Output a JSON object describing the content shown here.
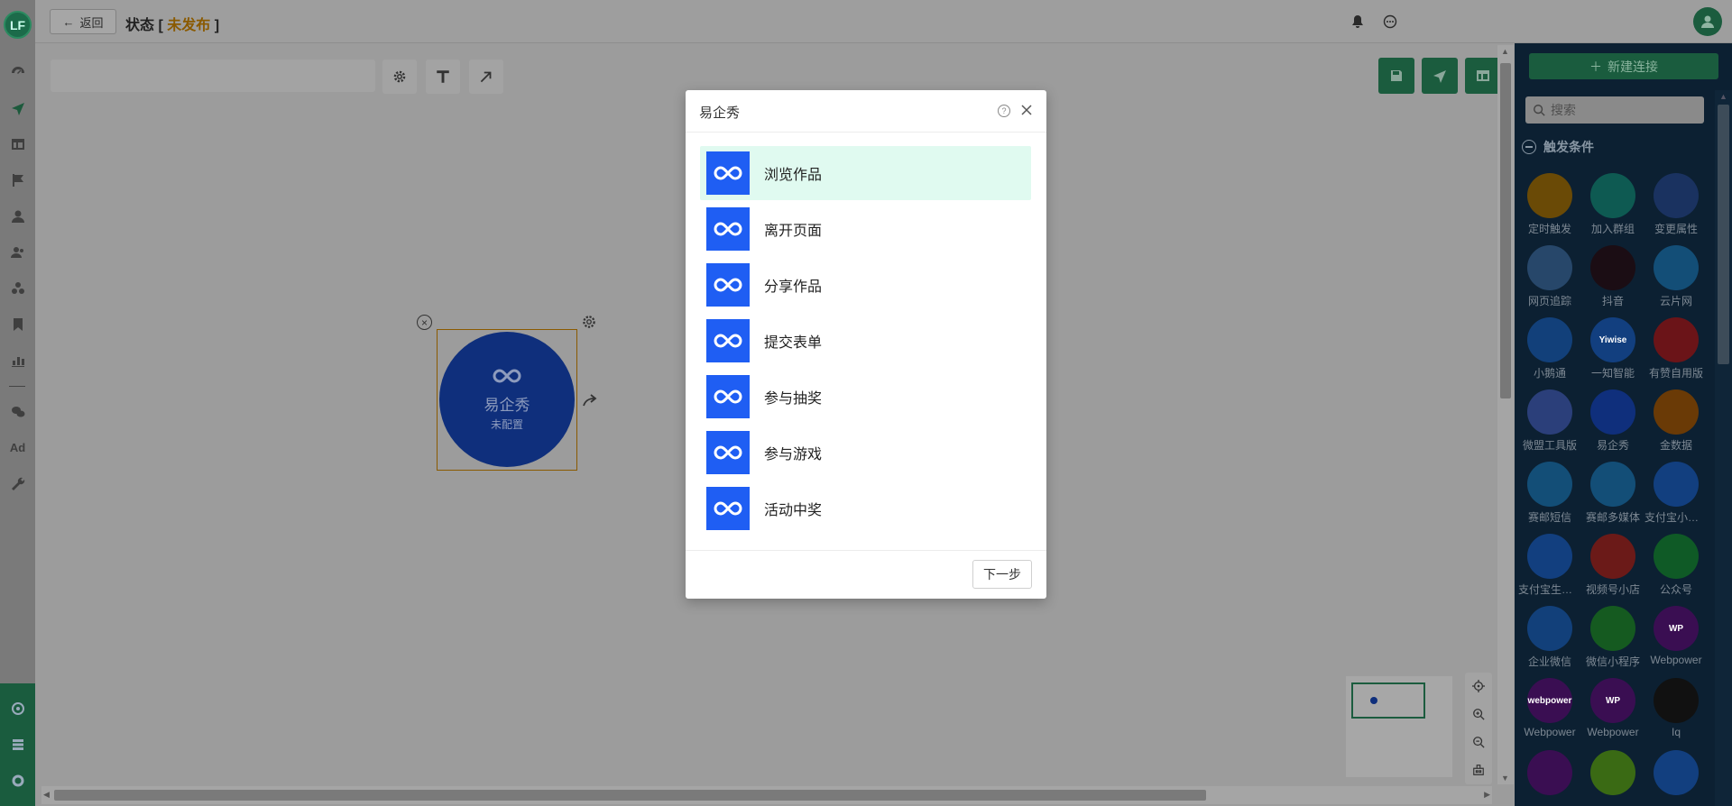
{
  "app": {
    "logo_text": "LF"
  },
  "header": {
    "back_label": "返回",
    "title_prefix": "状态",
    "bracket_open": "[",
    "status": "未发布",
    "bracket_close": "]"
  },
  "left_nav": {
    "items": [
      "dashboard-icon",
      "send-icon",
      "table-icon",
      "flag-icon",
      "user-icon",
      "user-group-icon",
      "segments-icon",
      "bookmark-icon",
      "bar-chart-icon",
      "wechat-icon",
      "wrench-icon"
    ],
    "ad_label": "Ad"
  },
  "canvas": {
    "node": {
      "label": "易企秀",
      "sublabel": "未配置"
    }
  },
  "right_panel": {
    "new_connection": "新建连接",
    "search_placeholder": "搜索",
    "section_title": "触发条件",
    "items": [
      {
        "label": "定时触发",
        "color": "#6a4a06",
        "text": ""
      },
      {
        "label": "加入群组",
        "color": "#0e5a52",
        "text": ""
      },
      {
        "label": "变更属性",
        "color": "#1a3260",
        "text": ""
      },
      {
        "label": "网页追踪",
        "color": "#27476a",
        "text": ""
      },
      {
        "label": "抖音",
        "color": "#1b0d14",
        "text": ""
      },
      {
        "label": "云片网",
        "color": "#134e77",
        "text": ""
      },
      {
        "label": "小鹅通",
        "color": "#12407a",
        "text": ""
      },
      {
        "label": "一知智能",
        "color": "#123f7f",
        "text": "Yiwise"
      },
      {
        "label": "有赞自用版",
        "color": "#6b1418",
        "text": ""
      },
      {
        "label": "微盟工具版",
        "color": "#2b3f7a",
        "text": ""
      },
      {
        "label": "易企秀",
        "color": "#0f2f7c",
        "text": ""
      },
      {
        "label": "金数据",
        "color": "#6a3a06",
        "text": ""
      },
      {
        "label": "赛邮短信",
        "color": "#134e77",
        "text": ""
      },
      {
        "label": "赛邮多媒体",
        "color": "#134e77",
        "text": ""
      },
      {
        "label": "支付宝小程序",
        "color": "#123f7f",
        "text": ""
      },
      {
        "label": "支付宝生活号",
        "color": "#123f7f",
        "text": ""
      },
      {
        "label": "视频号小店",
        "color": "#6b1a18",
        "text": ""
      },
      {
        "label": "公众号",
        "color": "#0f5a26",
        "text": ""
      },
      {
        "label": "企业微信",
        "color": "#12407a",
        "text": ""
      },
      {
        "label": "微信小程序",
        "color": "#155a20",
        "text": ""
      },
      {
        "label": "Webpower",
        "color": "#3a0e52",
        "text": "WP"
      },
      {
        "label": "Webpower",
        "color": "#3a0e52",
        "text": "webpower"
      },
      {
        "label": "Webpower",
        "color": "#3a0e52",
        "text": "WP"
      },
      {
        "label": "Iq",
        "color": "#111111",
        "text": ""
      },
      {
        "label": "",
        "color": "#3a0e52",
        "text": ""
      },
      {
        "label": "",
        "color": "#3a6a14",
        "text": ""
      },
      {
        "label": "",
        "color": "#123f7f",
        "text": ""
      }
    ]
  },
  "modal": {
    "title": "易企秀",
    "help": "?",
    "options": [
      {
        "label": "浏览作品",
        "selected": true
      },
      {
        "label": "离开页面",
        "selected": false
      },
      {
        "label": "分享作品",
        "selected": false
      },
      {
        "label": "提交表单",
        "selected": false
      },
      {
        "label": "参与抽奖",
        "selected": false
      },
      {
        "label": "参与游戏",
        "selected": false
      },
      {
        "label": "活动中奖",
        "selected": false
      }
    ],
    "next_label": "下一步"
  }
}
